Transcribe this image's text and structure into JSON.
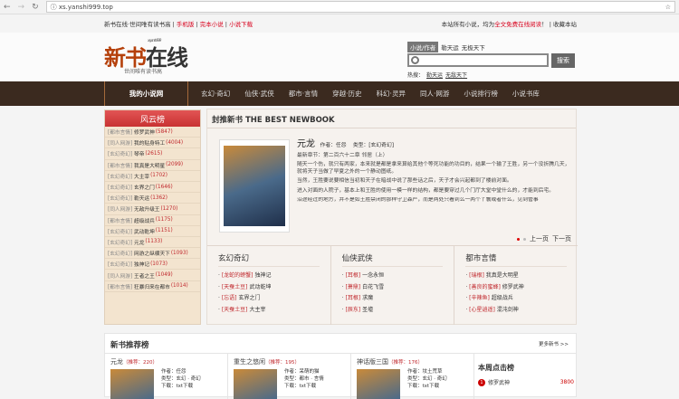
{
  "browser": {
    "url": "xs.yanshi999.top"
  },
  "topbar": {
    "slogan": "新书在线·世间唯有读书高",
    "links": [
      "手机版",
      "完本小说",
      "小说下载"
    ],
    "notice_pre": "本站所有小说，均为",
    "notice_red": "全文免费在线阅读",
    "notice_post": "！",
    "bookmark": "收藏本站"
  },
  "logo": {
    "main_a": "新书",
    "main_b": "在线",
    "sub": "世间唯有读书高",
    "url": "xsyanshi.999"
  },
  "search": {
    "tab": "小说/作者",
    "hot_inline": [
      "勒天运",
      "无极天下"
    ],
    "button": "搜索",
    "hot_label": "热搜：",
    "hot": [
      "勒天运",
      "无敌天下"
    ]
  },
  "nav": {
    "home": "我的小说网",
    "items": [
      "玄幻·奇幻",
      "仙侠·武侠",
      "都市·言情",
      "穿越·历史",
      "科幻·灵异",
      "同人·网游",
      "小说排行榜",
      "小说书库"
    ]
  },
  "sidebar": {
    "title": "风云榜",
    "items": [
      {
        "cat": "[都市言情]",
        "name": "修罗武神",
        "num": "(5847)"
      },
      {
        "cat": "[同人网游]",
        "name": "我的贴身特工",
        "num": "(4004)"
      },
      {
        "cat": "[玄幻奇幻]",
        "name": "琴帝",
        "num": "(2615)"
      },
      {
        "cat": "[都市言情]",
        "name": "我真是大明星",
        "num": "(2099)"
      },
      {
        "cat": "[玄幻奇幻]",
        "name": "大主宰",
        "num": "(1702)"
      },
      {
        "cat": "[玄幻奇幻]",
        "name": "玄界之门",
        "num": "(1646)"
      },
      {
        "cat": "[玄幻奇幻]",
        "name": "勒天运",
        "num": "(1362)"
      },
      {
        "cat": "[同人网游]",
        "name": "无敌升级王",
        "num": "(1270)"
      },
      {
        "cat": "[都市言情]",
        "name": "超级战兵",
        "num": "(1175)"
      },
      {
        "cat": "[玄幻奇幻]",
        "name": "武动乾坤",
        "num": "(1151)"
      },
      {
        "cat": "[玄幻奇幻]",
        "name": "元龙",
        "num": "(1133)"
      },
      {
        "cat": "[玄幻奇幻]",
        "name": "网游之纵横天下",
        "num": "(1093)"
      },
      {
        "cat": "[玄幻奇幻]",
        "name": "独神记",
        "num": "(1073)"
      },
      {
        "cat": "[同人网游]",
        "name": "王者之王",
        "num": "(1049)"
      },
      {
        "cat": "[都市言情]",
        "name": "狂暴归来在都市",
        "num": "(1014)"
      }
    ]
  },
  "featured": {
    "title": "封推新书 THE BEST NEWBOOK",
    "book": "元龙",
    "author": "作者：任怨",
    "type": "类型：[玄幻奇幻]",
    "latest": "最新章节：第二百六十二章 邻居（上）",
    "paras": [
      "随天一个伤，就只有两家，本来就是都是拿来算给其他个等死功能的功目的，结果一个输了王胜，另一个没折腾几天，就将天子当做了早夏之外的一个静动图纸。",
      "当然，王胜要说要相信当初和天子在暗战中说了那些话之后，天子才会兴起都到了楼前对面。",
      "进入对面的人院子，基本上和王胜的使用一模一样的结构，都是要穿过几个门厅大堂中堂什么的，才能到后宅。",
      "沿途经过的地方，并不是如王胜禁闭的那样守卫森严，而是两处只看到么一两个丫鬟或者什么，见到管事"
    ],
    "prev": "上一页",
    "next": "下一页"
  },
  "categories": [
    {
      "title": "玄幻奇幻",
      "items": [
        {
          "tag": "[龙蛇的螃蟹]",
          "name": "独神记"
        },
        {
          "tag": "[天蚕土豆]",
          "name": "武动乾坤"
        },
        {
          "tag": "[忘语]",
          "name": "玄界之门"
        },
        {
          "tag": "[天蚕土豆]",
          "name": "大主宰"
        }
      ]
    },
    {
      "title": "仙侠武侠",
      "items": [
        {
          "tag": "[耳根]",
          "name": "一念永恒"
        },
        {
          "tag": "[萧鼎]",
          "name": "白花飞雪"
        },
        {
          "tag": "[耳根]",
          "name": "求魔"
        },
        {
          "tag": "[辰东]",
          "name": "圣墟"
        }
      ]
    },
    {
      "title": "都市言情",
      "items": [
        {
          "tag": "[瑞根]",
          "name": "我真是大明星"
        },
        {
          "tag": "[善良的蜜蜂]",
          "name": "修罗武神"
        },
        {
          "tag": "[辛辣鱼]",
          "name": "超级战兵"
        },
        {
          "tag": "[心星逍遥]",
          "name": "混沌剑神"
        }
      ]
    }
  ],
  "recommend": {
    "title": "新书推荐榜",
    "more": "更多新书 >>",
    "books": [
      {
        "name": "元龙",
        "votes": "（推荐：220）",
        "author": "作者：任怨",
        "type": "类型：玄幻 · 奇幻",
        "dl": "下载：txt下载"
      },
      {
        "name": "重生之悠闲",
        "votes": "（推荐：195）",
        "author": "作者：呆萌的猫",
        "type": "类型：都市 · 言情",
        "dl": "下载：txt下载"
      },
      {
        "name": "神话版三国",
        "votes": "（推荐：176）",
        "author": "作者：坟土荒草",
        "type": "类型：玄幻 · 奇幻",
        "dl": "下载：txt下载"
      }
    ]
  },
  "weekly": {
    "title": "本周点击榜",
    "items": [
      {
        "rank": "1",
        "name": "修罗武神",
        "num": "3800"
      }
    ]
  }
}
